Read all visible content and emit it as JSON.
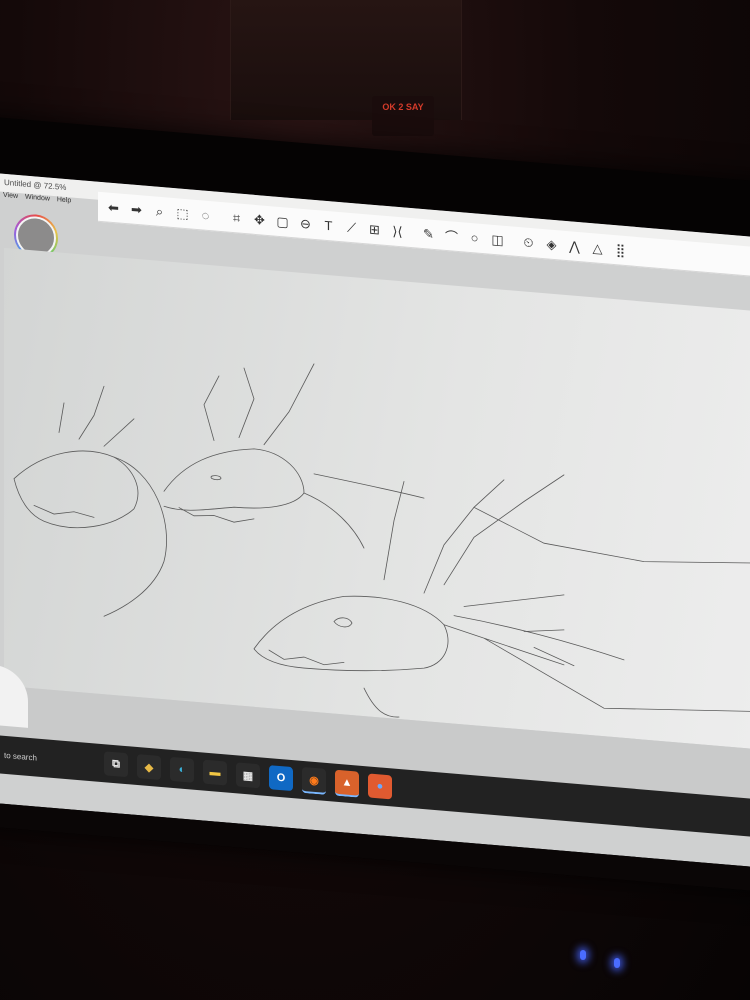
{
  "app": {
    "title": "Untitled @ 72.5%",
    "menu": [
      "View",
      "Window",
      "Help"
    ]
  },
  "toolbar": {
    "tools": [
      {
        "name": "undo-icon",
        "glyph": "⬅"
      },
      {
        "name": "redo-icon",
        "glyph": "➡"
      },
      {
        "name": "magnify-icon",
        "glyph": "⌕"
      },
      {
        "name": "selection-icon",
        "glyph": "⬚"
      },
      {
        "name": "lasso-icon",
        "glyph": "◌"
      },
      {
        "name": "crop-icon",
        "glyph": "⌗"
      },
      {
        "name": "transform-icon",
        "glyph": "✥"
      },
      {
        "name": "distort-icon",
        "glyph": "▢"
      },
      {
        "name": "fill-bucket-icon",
        "glyph": "⊖"
      },
      {
        "name": "text-tool-icon",
        "glyph": "T"
      },
      {
        "name": "ruler-icon",
        "glyph": "⟋"
      },
      {
        "name": "perspective-grid-icon",
        "glyph": "⊞"
      },
      {
        "name": "symmetry-icon",
        "glyph": "⟩⟨"
      },
      {
        "name": "brush-icon",
        "glyph": "✎"
      },
      {
        "name": "curve-icon",
        "glyph": "⌒"
      },
      {
        "name": "ellipse-icon",
        "glyph": "○"
      },
      {
        "name": "shapes-icon",
        "glyph": "◫"
      },
      {
        "name": "timelapse-icon",
        "glyph": "⏲"
      },
      {
        "name": "layers-icon",
        "glyph": "◈"
      },
      {
        "name": "brush-library-icon",
        "glyph": "⋀"
      },
      {
        "name": "color-editor-icon",
        "glyph": "△"
      },
      {
        "name": "swatches-icon",
        "glyph": "⣿"
      }
    ]
  },
  "taskbar": {
    "search_text": "to search",
    "apps": [
      {
        "name": "task-view-icon",
        "glyph": "⧉",
        "bg": "#2b2b2b",
        "fg": "#e6e6e6"
      },
      {
        "name": "copilot-icon",
        "glyph": "◆",
        "bg": "#2b2b2b",
        "fg": "#e7b946"
      },
      {
        "name": "edge-icon",
        "glyph": "◐",
        "bg": "#2b2b2b",
        "fg": "#3ab0d8"
      },
      {
        "name": "file-explorer-icon",
        "glyph": "▬",
        "bg": "#2b2b2b",
        "fg": "#f2c744"
      },
      {
        "name": "store-icon",
        "glyph": "▦",
        "bg": "#2b2b2b",
        "fg": "#e6e6e6"
      },
      {
        "name": "outlook-icon",
        "glyph": "O",
        "bg": "#1069c4",
        "fg": "#ffffff"
      },
      {
        "name": "firefox-icon",
        "glyph": "◉",
        "bg": "#2b2b2b",
        "fg": "#ff7a1a"
      },
      {
        "name": "sketchbook-icon",
        "glyph": "▲",
        "bg": "#d9622b",
        "fg": "#ffffff"
      },
      {
        "name": "app-icon",
        "glyph": "●",
        "bg": "#e05a30",
        "fg": "#6aa8ff"
      }
    ]
  },
  "room": {
    "sticker_text": "OK 2 SAY"
  }
}
